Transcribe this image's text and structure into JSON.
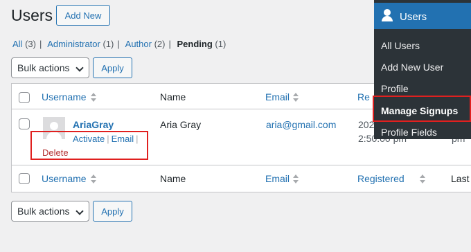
{
  "header": {
    "title": "Users",
    "add_new_label": "Add New"
  },
  "views": {
    "items": [
      {
        "label": "All",
        "count": "(3)",
        "current": false
      },
      {
        "label": "Administrator",
        "count": "(1)",
        "current": false
      },
      {
        "label": "Author",
        "count": "(2)",
        "current": false
      },
      {
        "label": "Pending",
        "count": "(1)",
        "current": true
      }
    ],
    "separator": "|"
  },
  "bulk_top": {
    "selected": "Bulk actions",
    "apply_label": "Apply"
  },
  "bulk_bottom": {
    "selected": "Bulk actions",
    "apply_label": "Apply"
  },
  "table": {
    "columns": {
      "username": "Username",
      "name": "Name",
      "email": "Email",
      "registered": "Registered",
      "last": "Last"
    },
    "header_partial": {
      "registered": "Re"
    },
    "row": {
      "username": "AriaGray",
      "name": "Aria Gray",
      "email": "aria@gmail.com",
      "registered_line1": "202",
      "registered_line2": "2:50:00 pm",
      "last_partial": "pm",
      "actions": {
        "activate": "Activate",
        "email": "Email",
        "delete": "Delete",
        "separator": "|"
      }
    }
  },
  "menu": {
    "header_label": "Users",
    "items": [
      {
        "label": "All Users",
        "active": false
      },
      {
        "label": "Add New User",
        "active": false
      },
      {
        "label": "Profile",
        "active": false
      },
      {
        "label": "Manage Signups",
        "active": true
      },
      {
        "label": "Profile Fields",
        "active": false
      }
    ]
  },
  "colors": {
    "link": "#2271b1",
    "menu_bg": "#2c3338",
    "menu_active_bg": "#2271b1",
    "highlight": "#e0201f",
    "delete": "#b32d2e"
  },
  "icons": {
    "sort": "sort-arrows-icon",
    "avatar": "avatar-placeholder-icon",
    "menu_user": "user-icon",
    "dropdown": "chevron-down-icon"
  }
}
